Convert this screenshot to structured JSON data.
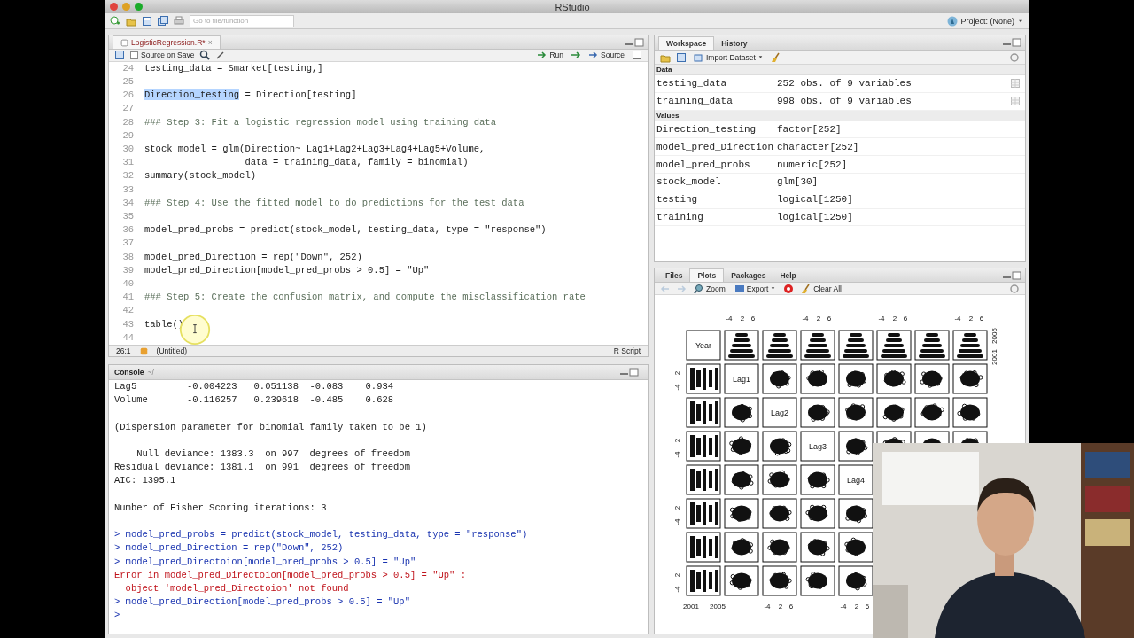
{
  "window": {
    "title": "RStudio"
  },
  "toolbar": {
    "search": {
      "placeholder": "Go to file/function"
    },
    "project": "Project: (None)"
  },
  "editor": {
    "tabs": [
      {
        "label": "LogisticRegression.R*",
        "close": "×",
        "selected": true
      }
    ],
    "source_on_save": {
      "label": "Source on Save",
      "checked": false
    },
    "buttons": [
      "Run",
      "Source"
    ],
    "lines": [
      {
        "number": "24",
        "text": "testing_data = Smarket[testing,]",
        "kind": "code"
      },
      {
        "number": "25"
      },
      {
        "number": "26",
        "parts": [
          {
            "text": "Direction_testing",
            "selected": true
          },
          {
            "text": " = Direction[testing]",
            "selected": false
          }
        ]
      },
      {
        "number": "27"
      },
      {
        "number": "28",
        "text": "### Step 3: Fit a logistic regression model using training data",
        "kind": "comment"
      },
      {
        "number": "29"
      },
      {
        "number": "30",
        "text": "stock_model = glm(Direction~ Lag1+Lag2+Lag3+Lag4+Lag5+Volume,",
        "kind": "code"
      },
      {
        "number": "31",
        "text": "                  data = training_data, family = binomial)",
        "kind": "code"
      },
      {
        "number": "32",
        "text": "summary(stock_model)",
        "kind": "code"
      },
      {
        "number": "33"
      },
      {
        "number": "34",
        "text": "### Step 4: Use the fitted model to do predictions for the test data",
        "kind": "comment"
      },
      {
        "number": "35"
      },
      {
        "number": "36",
        "text": "model_pred_probs = predict(stock_model, testing_data, type = \"response\")",
        "kind": "code"
      },
      {
        "number": "37"
      },
      {
        "number": "38",
        "text": "model_pred_Direction = rep(\"Down\", 252)",
        "kind": "code"
      },
      {
        "number": "39",
        "text": "model_pred_Direction[model_pred_probs > 0.5] = \"Up\"",
        "kind": "code"
      },
      {
        "number": "40"
      },
      {
        "number": "41",
        "text": "### Step 5: Create the confusion matrix, and compute the misclassification rate",
        "kind": "comment"
      },
      {
        "number": "42"
      },
      {
        "number": "43",
        "text": "table()",
        "kind": "code"
      },
      {
        "number": "44"
      }
    ],
    "status": {
      "position": "26:1",
      "scope": "(Untitled)",
      "file_type": "R Script"
    }
  },
  "console": {
    "title": "Console",
    "path": "~/",
    "lines": [
      {
        "kind": "output",
        "text": "Lag5         -0.004223   0.051138  -0.083    0.934"
      },
      {
        "kind": "output",
        "text": "Volume       -0.116257   0.239618  -0.485    0.628"
      },
      {
        "kind": "blank"
      },
      {
        "kind": "output",
        "text": "(Dispersion parameter for binomial family taken to be 1)"
      },
      {
        "kind": "blank"
      },
      {
        "kind": "output",
        "text": "    Null deviance: 1383.3  on 997  degrees of freedom"
      },
      {
        "kind": "output",
        "text": "Residual deviance: 1381.1  on 991  degrees of freedom"
      },
      {
        "kind": "output",
        "text": "AIC: 1395.1"
      },
      {
        "kind": "blank"
      },
      {
        "kind": "output",
        "text": "Number of Fisher Scoring iterations: 3"
      },
      {
        "kind": "blank"
      },
      {
        "kind": "input",
        "text": "> model_pred_probs = predict(stock_model, testing_data, type = \"response\")"
      },
      {
        "kind": "input",
        "text": "> model_pred_Direction = rep(\"Down\", 252)"
      },
      {
        "kind": "input",
        "text": "> model_pred_Directoion[model_pred_probs > 0.5] = \"Up\""
      },
      {
        "kind": "error",
        "text": "Error in model_pred_Directoion[model_pred_probs > 0.5] = \"Up\" :"
      },
      {
        "kind": "error",
        "text": "  object 'model_pred_Directoion' not found"
      },
      {
        "kind": "input",
        "text": "> model_pred_Direction[model_pred_probs > 0.5] = \"Up\""
      },
      {
        "kind": "input",
        "text": ">"
      }
    ]
  },
  "workspace": {
    "tabs": [
      {
        "label": "Workspace",
        "selected": true
      },
      {
        "label": "History",
        "selected": false
      }
    ],
    "import_button": "Import Dataset",
    "sections": [
      {
        "title": "Data",
        "rows": [
          {
            "name": "testing_data",
            "value": "252 obs. of 9 variables",
            "kind": "data"
          },
          {
            "name": "training_data",
            "value": "998 obs. of 9 variables",
            "kind": "data"
          }
        ]
      },
      {
        "title": "Values",
        "rows": [
          {
            "name": "Direction_testing",
            "value": "factor[252]",
            "kind": "value"
          },
          {
            "name": "model_pred_Direction",
            "value": "character[252]",
            "kind": "value"
          },
          {
            "name": "model_pred_probs",
            "value": "numeric[252]",
            "kind": "value"
          },
          {
            "name": "stock_model",
            "value": "glm[30]",
            "kind": "value"
          },
          {
            "name": "testing",
            "value": "logical[1250]",
            "kind": "value"
          },
          {
            "name": "training",
            "value": "logical[1250]",
            "kind": "value"
          }
        ]
      }
    ]
  },
  "plots_pane": {
    "tabs": [
      {
        "label": "Files",
        "selected": false
      },
      {
        "label": "Plots",
        "selected": true
      },
      {
        "label": "Packages",
        "selected": false
      },
      {
        "label": "Help",
        "selected": false
      }
    ],
    "zoom_button": "Zoom",
    "export_button": "Export",
    "clear_button": "Clear All",
    "plot": {
      "diagonal_labels": [
        "Year",
        "Lag1",
        "Lag2",
        "Lag3",
        "Lag4"
      ],
      "top_ticks": [
        [
          "-4",
          "2",
          "6"
        ],
        [
          "-4",
          "2",
          "6"
        ],
        [
          "-4",
          "2",
          "6"
        ],
        [
          "-4",
          "2",
          "6"
        ]
      ],
      "right_ticks": [
        "2005",
        "2001"
      ],
      "left_ticks": [
        [
          "2",
          "-4"
        ],
        [
          "2",
          "-4"
        ],
        [
          "2",
          "-4"
        ],
        [
          "2",
          "-4"
        ]
      ],
      "bottom_ticks": [
        [
          "2001",
          "2005"
        ],
        [
          "-4",
          "2",
          "6"
        ],
        [
          "-4",
          "2",
          "6"
        ]
      ]
    }
  }
}
